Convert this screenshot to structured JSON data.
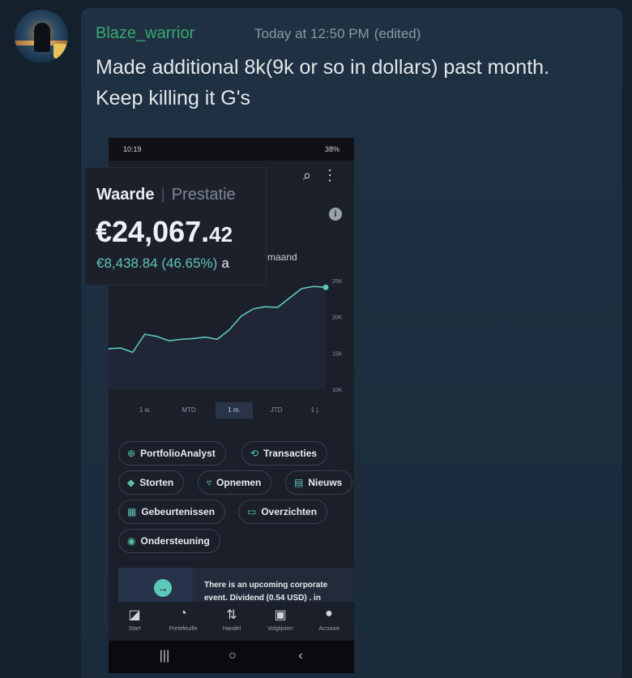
{
  "message": {
    "username": "Blaze_warrior",
    "timestamp": "Today at 12:50 PM",
    "edited": "(edited)",
    "text_line1": "Made additional 8k(9k or so in dollars) past month.",
    "text_line2": "Keep killing it G's"
  },
  "phone": {
    "status_time": "10:19",
    "status_battery": "38%",
    "top_icons": [
      "search-icon",
      "more-vert-icon"
    ],
    "info_icon": "i",
    "period_label": "maand",
    "overlay": {
      "tab_active": "Waarde",
      "tab_inactive": "Prestatie",
      "value_main": "€24,067.",
      "value_cents": "42",
      "gain": "€8,438.84 (46.65%)",
      "gain_suffix": "a"
    },
    "chart_data": {
      "type": "line",
      "y_ticks": [
        "25K",
        "20K",
        "15K",
        "10K"
      ],
      "ylim": [
        10000,
        25000
      ],
      "values": [
        15600,
        15700,
        15100,
        17600,
        17300,
        16700,
        16900,
        17000,
        17200,
        16900,
        18200,
        20100,
        21100,
        21400,
        21300,
        22600,
        23900,
        24200,
        24067
      ],
      "line_color": "#5cc8b8"
    },
    "range_tabs": [
      "1 w.",
      "MTD",
      "1 m.",
      "JTD",
      "1 j."
    ],
    "active_range": "1 m.",
    "actions": [
      {
        "label": "PortfolioAnalyst",
        "icon": "analyst-icon",
        "glyph": "⊕"
      },
      {
        "label": "Transacties",
        "icon": "transactions-icon",
        "glyph": "⟲"
      },
      {
        "label": "Storten",
        "icon": "deposit-icon",
        "glyph": "◆"
      },
      {
        "label": "Opnemen",
        "icon": "withdraw-icon",
        "glyph": "▿"
      },
      {
        "label": "Nieuws",
        "icon": "news-icon",
        "glyph": "▤"
      },
      {
        "label": "Gebeurtenissen",
        "icon": "calendar-icon",
        "glyph": "▦"
      },
      {
        "label": "Overzichten",
        "icon": "statements-icon",
        "glyph": "▭"
      },
      {
        "label": "Ondersteuning",
        "icon": "support-icon",
        "glyph": "◉"
      }
    ],
    "card_arrow": "→",
    "card_text": "There is an upcoming corporate event. Dividend (0.54 USD) . in",
    "bottom_nav": [
      {
        "label": "Start",
        "icon": "home-chart-icon",
        "glyph": "◪"
      },
      {
        "label": "Portefeuille",
        "icon": "portfolio-icon",
        "glyph": "◔"
      },
      {
        "label": "Handel",
        "icon": "trade-icon",
        "glyph": "⇅"
      },
      {
        "label": "Volglijsten",
        "icon": "watchlist-icon",
        "glyph": "▣"
      },
      {
        "label": "Account",
        "icon": "account-icon",
        "glyph": "●"
      }
    ],
    "system_nav": [
      {
        "name": "recent-apps-button",
        "glyph": "|||"
      },
      {
        "name": "home-button",
        "glyph": "○"
      },
      {
        "name": "back-button",
        "glyph": "‹"
      }
    ]
  }
}
